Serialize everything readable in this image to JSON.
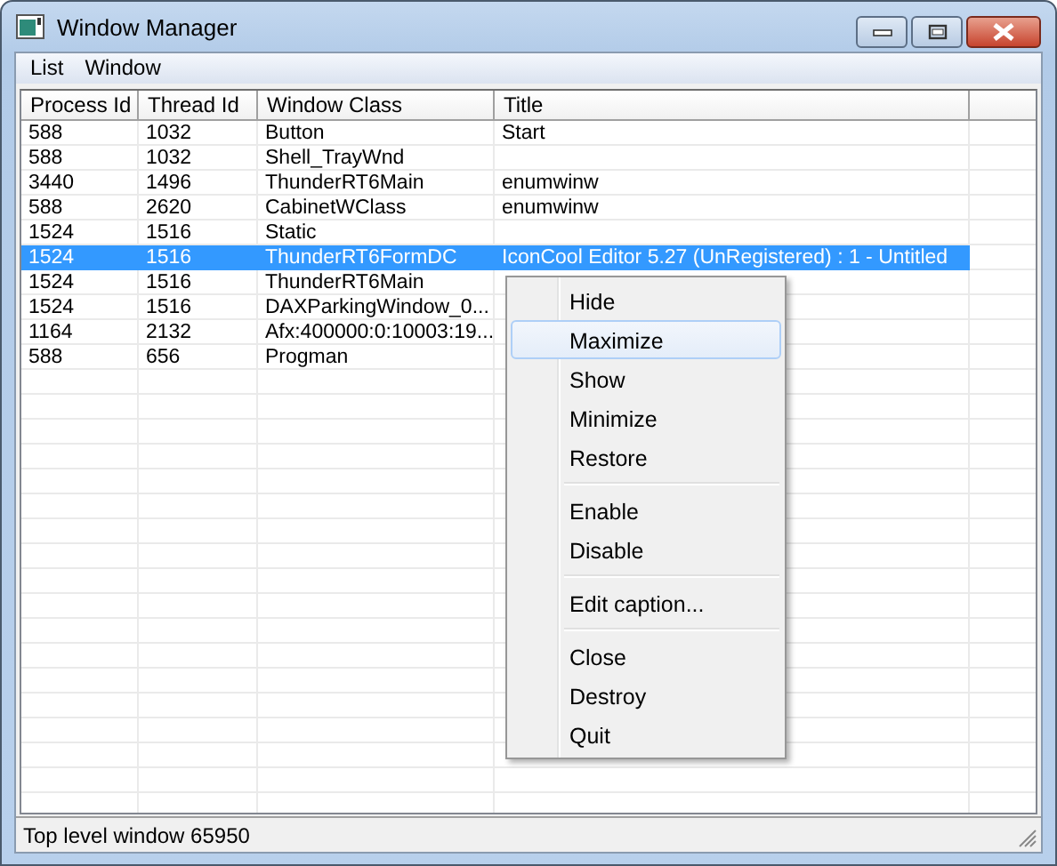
{
  "window": {
    "title": "Window Manager"
  },
  "menu_bar": [
    "List",
    "Window"
  ],
  "table": {
    "columns": [
      "Process Id",
      "Thread Id",
      "Window Class",
      "Title"
    ],
    "rows": [
      {
        "process_id": "588",
        "thread_id": "1032",
        "window_class": "Button",
        "title": "Start",
        "selected": false
      },
      {
        "process_id": "588",
        "thread_id": "1032",
        "window_class": "Shell_TrayWnd",
        "selected": false
      },
      {
        "process_id": "3440",
        "thread_id": "1496",
        "window_class": "ThunderRT6Main",
        "title": "enumwinw",
        "selected": false
      },
      {
        "process_id": "588",
        "thread_id": "2620",
        "window_class": "CabinetWClass",
        "title": "enumwinw",
        "selected": false
      },
      {
        "process_id": "1524",
        "thread_id": "1516",
        "window_class": "Static",
        "selected": false
      },
      {
        "process_id": "1524",
        "thread_id": "1516",
        "window_class": "ThunderRT6FormDC",
        "title": "IconCool Editor 5.27 (UnRegistered) : 1 - Untitled",
        "selected": true
      },
      {
        "process_id": "1524",
        "thread_id": "1516",
        "window_class": "ThunderRT6Main",
        "selected": false
      },
      {
        "process_id": "1524",
        "thread_id": "1516",
        "window_class": "DAXParkingWindow_0...",
        "selected": false
      },
      {
        "process_id": "1164",
        "thread_id": "2132",
        "window_class": "Afx:400000:0:10003:19...",
        "selected": false
      },
      {
        "process_id": "588",
        "thread_id": "656",
        "window_class": "Progman",
        "selected": false
      }
    ]
  },
  "context_menu": [
    {
      "kind": "item",
      "label": "Hide",
      "highlighted": false
    },
    {
      "kind": "item",
      "label": "Maximize",
      "highlighted": true
    },
    {
      "kind": "item",
      "label": "Show",
      "highlighted": false
    },
    {
      "kind": "item",
      "label": "Minimize",
      "highlighted": false
    },
    {
      "kind": "item",
      "label": "Restore",
      "highlighted": false
    },
    {
      "kind": "separator"
    },
    {
      "kind": "item",
      "label": "Enable",
      "highlighted": false
    },
    {
      "kind": "item",
      "label": "Disable",
      "highlighted": false
    },
    {
      "kind": "separator"
    },
    {
      "kind": "item",
      "label": "Edit caption...",
      "highlighted": false
    },
    {
      "kind": "separator"
    },
    {
      "kind": "item",
      "label": "Close",
      "highlighted": false
    },
    {
      "kind": "item",
      "label": "Destroy",
      "highlighted": false
    },
    {
      "kind": "item",
      "label": "Quit",
      "highlighted": false
    }
  ],
  "status_bar": "Top level window 65950"
}
